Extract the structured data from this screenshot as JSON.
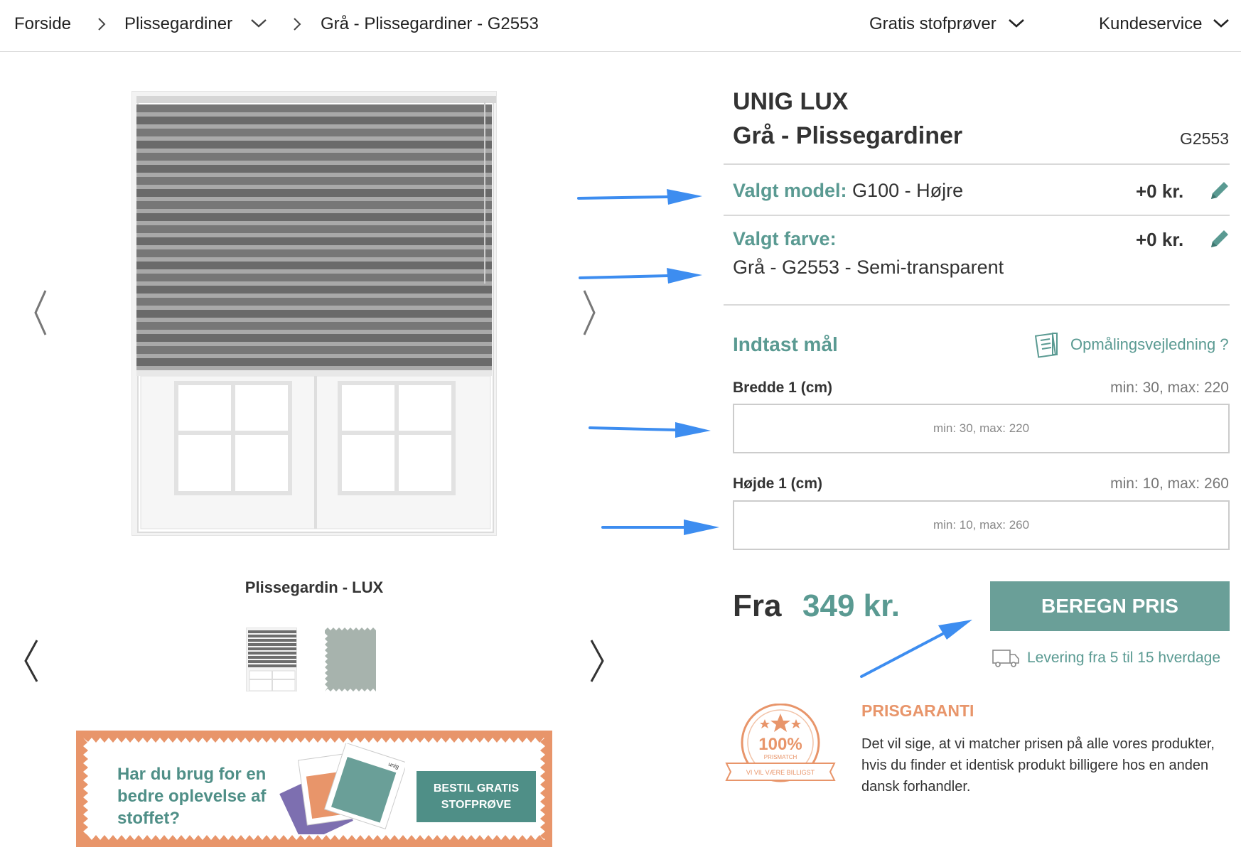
{
  "breadcrumb": {
    "home": "Forside",
    "category": "Plissegardiner",
    "current": "Grå - Plissegardiner - G2553"
  },
  "nav": {
    "samples": "Gratis stofprøver",
    "service": "Kundeservice"
  },
  "gallery": {
    "caption": "Plissegardin - LUX"
  },
  "promo": {
    "text": "Har du brug for en bedre oplevelse af stoffet?",
    "button_line1": "BESTIL GRATIS",
    "button_line2": "STOFPRØVE",
    "swatch_brand": "unig"
  },
  "product": {
    "brand": "UNIG LUX",
    "title": "Grå - Plissegardiner",
    "sku": "G2553"
  },
  "model": {
    "label": "Valgt model:",
    "value": "G100 - Højre",
    "price": "+0 kr."
  },
  "color": {
    "label": "Valgt farve:",
    "value": "Grå - G2553 - Semi-transparent",
    "price": "+0 kr."
  },
  "measure": {
    "title": "Indtast mål",
    "guide": "Opmålingsvejledning ?",
    "width_label": "Bredde 1 (cm)",
    "width_hint": "min: 30, max: 220",
    "width_placeholder": "min: 30, max: 220",
    "width_value": "",
    "height_label": "Højde 1 (cm)",
    "height_hint": "min: 10, max: 260",
    "height_placeholder": "min: 10, max: 260",
    "height_value": ""
  },
  "pricing": {
    "from_label": "Fra",
    "from_price": "349 kr.",
    "button": "BEREGN PRIS",
    "delivery": "Levering fra 5 til 15 hverdage"
  },
  "guarantee": {
    "title": "PRISGARANTI",
    "text": "Det vil sige, at vi matcher prisen på alle vores produkter, hvis du finder et identisk produkt billigere hos en anden dansk forhandler.",
    "badge_percent": "100%",
    "badge_label": "PRISMATCH",
    "badge_ribbon": "VI VIL VÆRE BILLIGST"
  },
  "colors": {
    "accent": "#5a9a92",
    "button": "#6a9f98",
    "orange": "#e8956a",
    "annotation": "#3d8df0"
  }
}
